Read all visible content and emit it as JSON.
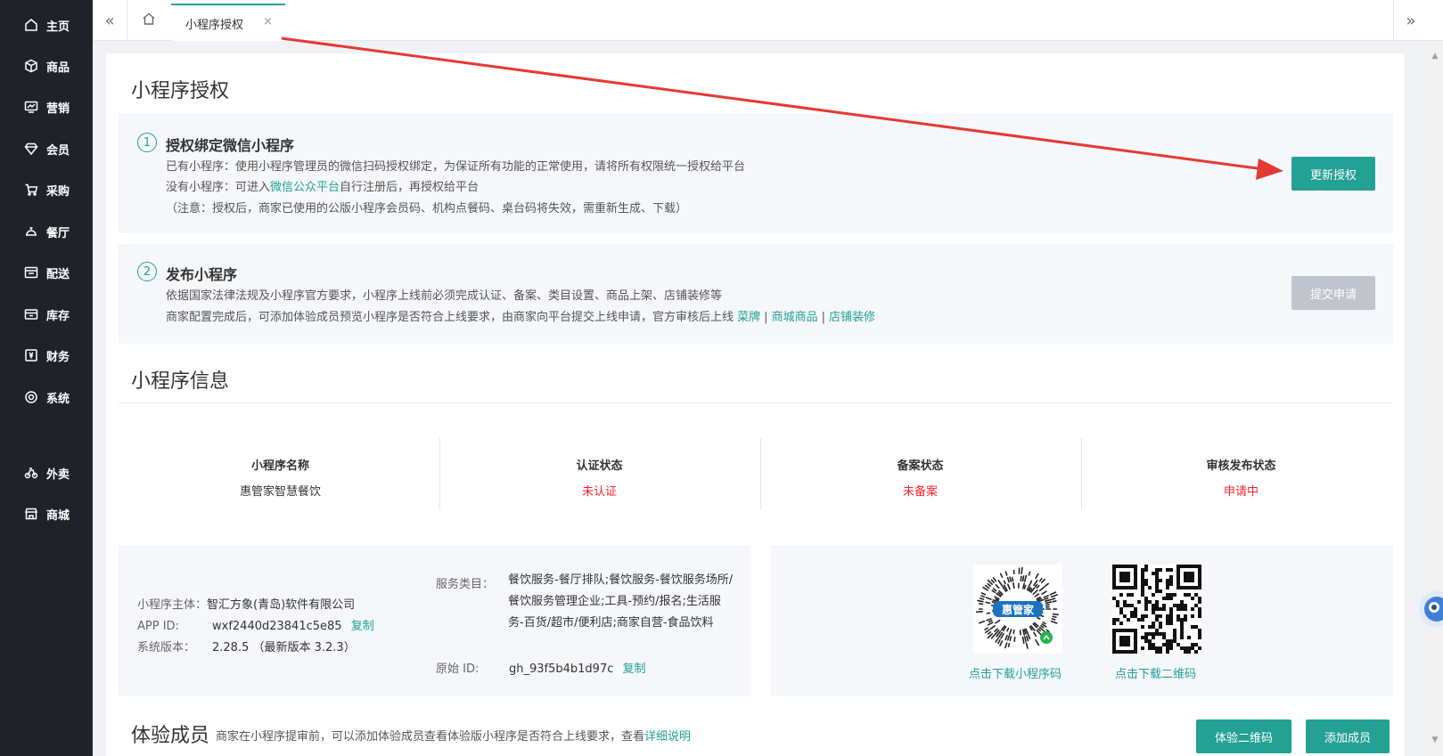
{
  "sidebar": {
    "items": [
      {
        "label": "主页",
        "icon": "home-icon"
      },
      {
        "label": "商品",
        "icon": "box-icon"
      },
      {
        "label": "营销",
        "icon": "chart-icon"
      },
      {
        "label": "会员",
        "icon": "diamond-icon"
      },
      {
        "label": "采购",
        "icon": "cart-icon"
      },
      {
        "label": "餐厅",
        "icon": "bell-icon"
      },
      {
        "label": "配送",
        "icon": "truck-icon"
      },
      {
        "label": "库存",
        "icon": "warehouse-icon"
      },
      {
        "label": "财务",
        "icon": "finance-icon"
      },
      {
        "label": "系统",
        "icon": "settings-icon"
      },
      {
        "label": "外卖",
        "icon": "bike-icon"
      },
      {
        "label": "商城",
        "icon": "store-icon"
      }
    ]
  },
  "tabbar": {
    "active_tab": "小程序授权",
    "close_glyph": "×",
    "prev_glyph": "«",
    "next_glyph": "»"
  },
  "auth": {
    "title": "小程序授权",
    "step1": {
      "num": "1",
      "title": "授权绑定微信小程序",
      "line1": "已有小程序：使用小程序管理员的微信扫码授权绑定，为保证所有功能的正常使用，请将所有权限统一授权给平台",
      "line2_prefix": "没有小程序：可进入",
      "line2_link": "微信公众平台",
      "line2_suffix": "自行注册后，再授权给平台",
      "line3": "（注意：授权后，商家已使用的公版小程序会员码、机构点餐码、桌台码将失效，需重新生成、下载）",
      "button": "更新授权"
    },
    "step2": {
      "num": "2",
      "title": "发布小程序",
      "line1": "依据国家法律法规及小程序官方要求，小程序上线前必须完成认证、备案、类目设置、商品上架、店铺装修等",
      "line2_prefix": "商家配置完成后，可添加体验成员预览小程序是否符合上线要求，由商家向平台提交上线申请，官方审核后上线",
      "link1": "菜牌",
      "link2": "商城商品",
      "link3": "店铺装修",
      "pipe": "|",
      "button": "提交申请"
    }
  },
  "info": {
    "title": "小程序信息",
    "status": [
      {
        "label": "小程序名称",
        "value": "惠管家智慧餐饮",
        "red": false
      },
      {
        "label": "认证状态",
        "value": "未认证",
        "red": true
      },
      {
        "label": "备案状态",
        "value": "未备案",
        "red": true
      },
      {
        "label": "审核发布状态",
        "value": "申请中",
        "red": true
      }
    ],
    "entity_label": "小程序主体：",
    "entity_value": "智汇方象(青岛)软件有限公司",
    "appid_label": "APP ID:",
    "appid_value": "wxf2440d23841c5e85",
    "copy_label": "复制",
    "version_label": "系统版本：",
    "version_value": "2.28.5 （最新版本 3.2.3）",
    "service_label": "服务类目：",
    "service_value": "餐饮服务-餐厅排队;餐饮服务-餐饮服务场所/餐饮服务管理企业;工具-预约/报名;生活服务-百货/超市/便利店;商家自营-食品饮料",
    "origin_label": "原始 ID:",
    "origin_value": "gh_93f5b4b1d97c",
    "qr_mini_caption": "点击下载小程序码",
    "qr_code_caption": "点击下载二维码",
    "logo_text": "惠管家"
  },
  "members": {
    "title": "体验成员",
    "note_prefix": "商家在小程序提审前，可以添加体验成员查看体验版小程序是否符合上线要求，查看",
    "note_link": "详细说明",
    "btn_qr": "体验二维码",
    "btn_add": "添加成员"
  },
  "colors": {
    "accent": "#23a194",
    "danger": "#f5222d",
    "annotation_arrow": "#e53935",
    "sidebar_bg": "#1f2329"
  }
}
